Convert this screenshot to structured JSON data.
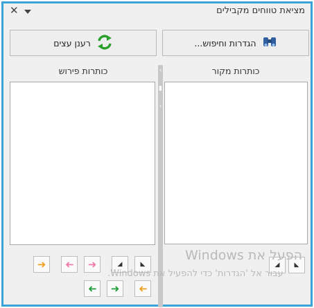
{
  "window": {
    "title": "מציאת טווחים מקבילים"
  },
  "toolbar": {
    "settings_label": "הגדרות וחיפוש...",
    "refresh_label": "רענן עצים"
  },
  "panels": {
    "source_label": "כותרות מקור",
    "target_label": "כותרות פירוש"
  },
  "controls": {
    "arrow_colors": {
      "orange": "#f0a020",
      "pink": "#f07aa8",
      "green": "#1f9e3a"
    }
  },
  "watermark": {
    "line1": "Windows הפעל את",
    "line2": "עבור אל 'הגדרות' כדי להפעיל את Windows."
  },
  "colors": {
    "accent": "#3aa3d9"
  }
}
